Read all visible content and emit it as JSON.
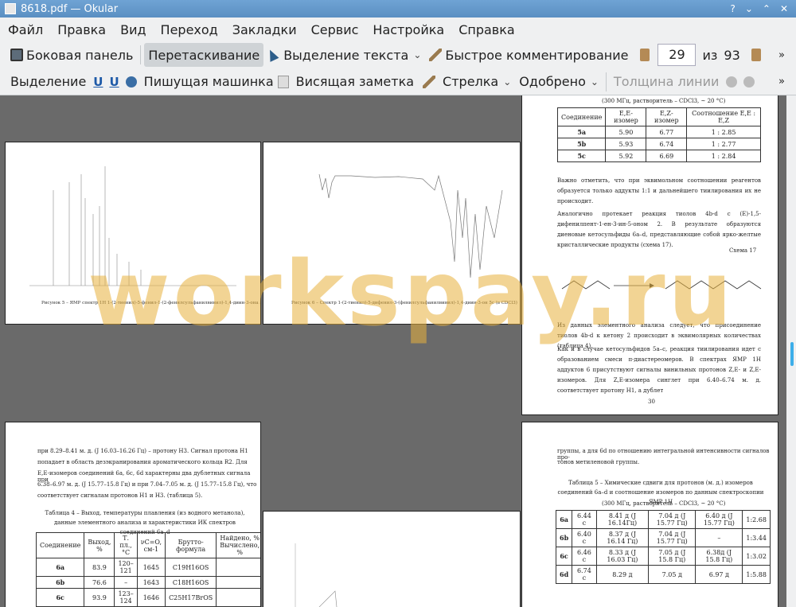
{
  "window": {
    "title": "8618.pdf  — Okular"
  },
  "menu": [
    "Файл",
    "Правка",
    "Вид",
    "Переход",
    "Закладки",
    "Сервис",
    "Настройка",
    "Справка"
  ],
  "toolbar1": {
    "sidebar": "Боковая панель",
    "drag": "Перетаскивание",
    "text_select": "Выделение текста",
    "quick_comment": "Быстрое комментирование",
    "page_current": "29",
    "page_of": "из",
    "page_total": "93"
  },
  "toolbar2": {
    "selection": "Выделение",
    "typewriter": "Пишущая машинка",
    "sticky_note": "Висящая заметка",
    "arrow": "Стрелка",
    "approved": "Одобрено",
    "line_width": "Толщина линии"
  },
  "watermark": "workspay.ru",
  "pages": {
    "nmr_caption": "Рисунок 5 – ЯМР спектр 1Н 1-(2-тиенил)-5-фенил-1-(2-фенилсульфанилвинил)-1,4-диин-3-она 5c (300 МГц)",
    "ir_caption": "Рисунок 6 – Спектр 1-(2-тиенил)-5-дифенил-3-(фенилсульфанилвинил)-1,4-диин-3-он 5c (в CDCl3)",
    "p30": {
      "header": "(300 МГц, растворитель – CDCl3, ~ 20 °C)",
      "table": {
        "cols": [
          "Соединение",
          "E,E-изомер",
          "E,Z-изомер",
          "Соотношение E,E : E,Z"
        ],
        "rows": [
          [
            "5a",
            "5.90",
            "6.77",
            "1 : 2.85"
          ],
          [
            "5b",
            "5.93",
            "6.74",
            "1 : 2.77"
          ],
          [
            "5c",
            "5.92",
            "6.69",
            "1 : 2.84"
          ]
        ]
      },
      "para1": "Важно отметить, что при эквимольном соотношении реагентов образуется только аддукты 1:1 и дальнейшего тиилирования их не происходит.",
      "para2": "Аналогично протекает реакция тиолов 4b-d с (E)-1,5-дифенилпент-1-ен-3-ин-5-оном 2. В результате образуются диеновые кетосульфиды 6a–d, представляющие собой ярко-желтые кристаллические продукты (схема 17).",
      "scheme": "Схема 17",
      "para3": "Из данных элементного анализа следует, что присоединение тиолов 4b-d к кетону 2 происходит в эквимолярных количествах (таблица 4).",
      "para4": "Как и в случае кетосульфидов 5a–c, реакция тиилирования идет с образованием смеси π-диастереомеров. В спектрах ЯМР 1Н аддуктов 6 присутствуют сигналы винильных протонов Z,E- и Z,E-изомеров. Для Z,E-изомера синглет при 6.40–6.74 м. д. соответствует протону H1, а дублет",
      "page_no": "30"
    },
    "p31left": {
      "lines": [
        "при 8.29–8.41 м. д. (J 16.03–16.26 Гц) – протону H3. Сигнал протона H1",
        "попадает в область дезэкранирования ароматического кольца R2. Для",
        "E,E-изомеров соединений 6a, 6c, 6d характерны два дублетных сигнала при",
        "6.38–6.97 м. д. (J 15.77–15.8 Гц) и при 7.04–7.05 м. д. (J 15.77–15.8 Гц), что",
        "соответствует сигналам протонов H1 и H3. (таблица 5)."
      ],
      "table_title": "Таблица 4 – Выход, температуры плавления (из водного метанола), данные элементного анализа и характеристики ИК спектров соединений 6a–d",
      "table": {
        "cols": [
          "Соединение",
          "Выход, %",
          "Т. пл., °С",
          "νC=O, см-1",
          "Брутто-формула",
          "Найдено, % Вычислено, %"
        ],
        "rows": [
          [
            "6a",
            "83.9",
            "120–121",
            "1645",
            "C19H16OS"
          ],
          [
            "6b",
            "76.6",
            "–",
            "1643",
            "C18H16OS"
          ],
          [
            "6c",
            "93.9",
            "123–124",
            "1646",
            "C25H17BrOS"
          ]
        ]
      }
    },
    "p31right": {
      "line1": "группы, а для 6d по отношению интегральной интенсивности сигналов про-",
      "line2": "тонов метиленовой группы.",
      "table_title": "Таблица 5 – Химические сдвиги для протонов (м. д.) изомеров соединений 6a–d и соотношение изомеров по данным спектроскопии ЯМР 1Н",
      "subtitle": "(300 МГц, растворитель – CDCl3, ~ 20 °C)",
      "rows": [
        [
          "6a",
          "6.44 с",
          "8.41 д (J 16.14Гц)",
          "7.04 д (J 15.77 Гц)",
          "6.40 д (J 15.77 Гц)",
          "1:2.68"
        ],
        [
          "6b",
          "6.40 с",
          "8.37 д (J 16.14 Гц)",
          "7.04 д (J 15.77 Гц)",
          "–",
          "1:3.44"
        ],
        [
          "6c",
          "6.46 с",
          "8.33 д (J 16.03 Гц)",
          "7.05 д (J 15.8 Гц)",
          "6.38д (J 15.8 Гц)",
          "1:3.02"
        ],
        [
          "6d",
          "6.74 с",
          "8.29 д",
          "7.05 д",
          "6.97 д",
          "1:5.88"
        ]
      ]
    }
  }
}
